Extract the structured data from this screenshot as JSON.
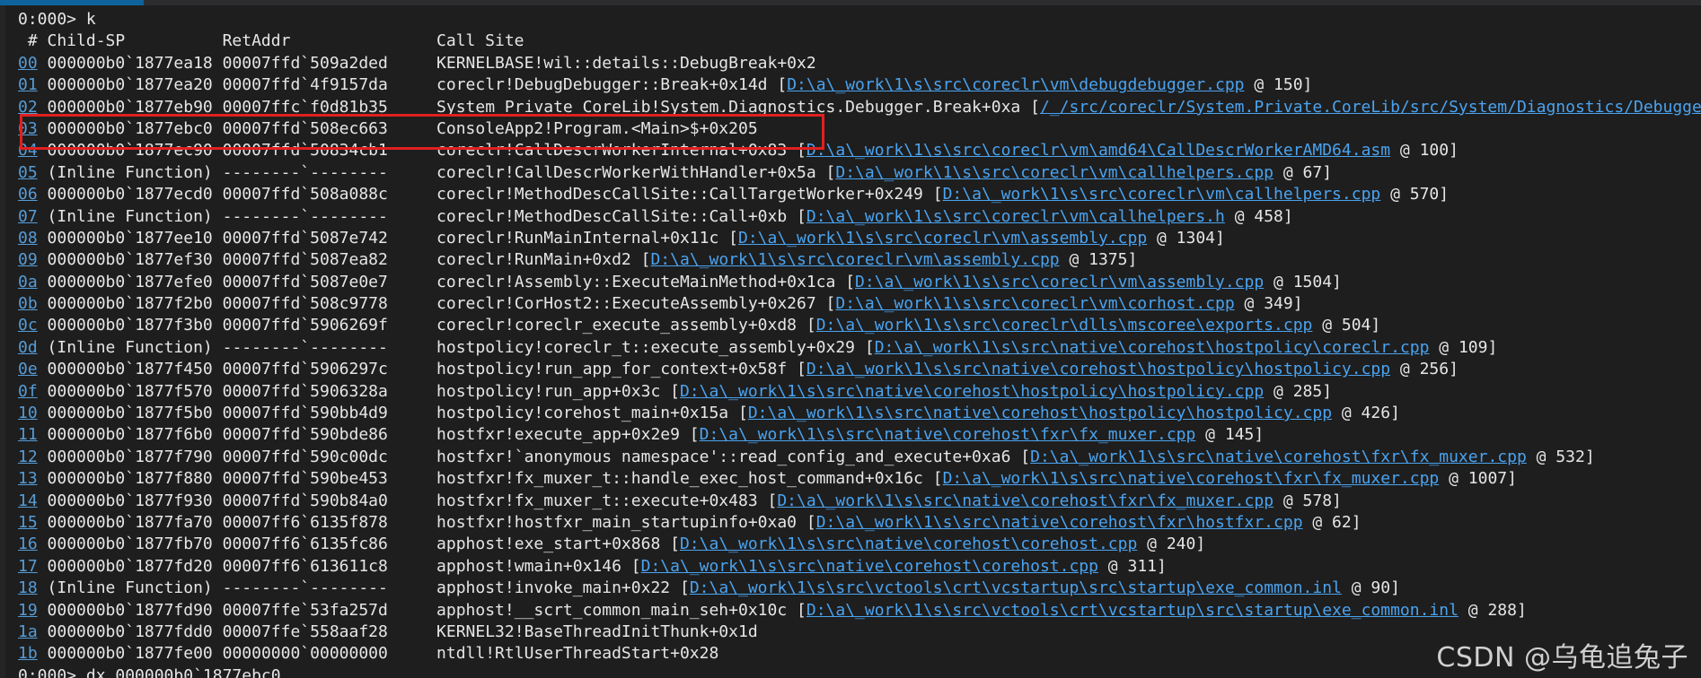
{
  "console": {
    "prompt_line": "0:000> k",
    "header": " # Child-SP          RetAddr               Call Site",
    "frames": [
      {
        "num": "00",
        "child_sp": "000000b0`1877ea18",
        "ret_addr": "00007ffd`509a2ded",
        "call_site": "KERNELBASE!wil::details::DebugBreak+0x2",
        "source_path": "",
        "line_suffix": ""
      },
      {
        "num": "01",
        "child_sp": "000000b0`1877ea20",
        "ret_addr": "00007ffd`4f9157da",
        "call_site": "coreclr!DebugDebugger::Break+0x14d",
        "source_path": "D:\\a\\_work\\1\\s\\src\\coreclr\\vm\\debugdebugger.cpp",
        "line_suffix": " @ 150]"
      },
      {
        "num": "02",
        "child_sp": "000000b0`1877eb90",
        "ret_addr": "00007ffc`f0d81b35",
        "call_site": "System_Private_CoreLib!System.Diagnostics.Debugger.Break+0xa",
        "source_path": "/_/src/coreclr/System.Private.CoreLib/src/System/Diagnostics/Debugger.cs",
        "line_suffix": ""
      },
      {
        "num": "03",
        "child_sp": "000000b0`1877ebc0",
        "ret_addr": "00007ffd`508ec663",
        "call_site": "ConsoleApp2!Program.<Main>$+0x205",
        "source_path": "",
        "line_suffix": ""
      },
      {
        "num": "04",
        "child_sp": "000000b0`1877ec90",
        "ret_addr": "00007ffd`50834cb1",
        "call_site": "coreclr!CallDescrWorkerInternal+0x83",
        "source_path": "D:\\a\\_work\\1\\s\\src\\coreclr\\vm\\amd64\\CallDescrWorkerAMD64.asm",
        "line_suffix": " @ 100]"
      },
      {
        "num": "05",
        "child_sp": "(Inline Function)",
        "ret_addr": "--------`--------",
        "call_site": "coreclr!CallDescrWorkerWithHandler+0x5a",
        "source_path": "D:\\a\\_work\\1\\s\\src\\coreclr\\vm\\callhelpers.cpp",
        "line_suffix": " @ 67]"
      },
      {
        "num": "06",
        "child_sp": "000000b0`1877ecd0",
        "ret_addr": "00007ffd`508a088c",
        "call_site": "coreclr!MethodDescCallSite::CallTargetWorker+0x249",
        "source_path": "D:\\a\\_work\\1\\s\\src\\coreclr\\vm\\callhelpers.cpp",
        "line_suffix": " @ 570]"
      },
      {
        "num": "07",
        "child_sp": "(Inline Function)",
        "ret_addr": "--------`--------",
        "call_site": "coreclr!MethodDescCallSite::Call+0xb",
        "source_path": "D:\\a\\_work\\1\\s\\src\\coreclr\\vm\\callhelpers.h",
        "line_suffix": " @ 458]"
      },
      {
        "num": "08",
        "child_sp": "000000b0`1877ee10",
        "ret_addr": "00007ffd`5087e742",
        "call_site": "coreclr!RunMainInternal+0x11c",
        "source_path": "D:\\a\\_work\\1\\s\\src\\coreclr\\vm\\assembly.cpp",
        "line_suffix": " @ 1304]"
      },
      {
        "num": "09",
        "child_sp": "000000b0`1877ef30",
        "ret_addr": "00007ffd`5087ea82",
        "call_site": "coreclr!RunMain+0xd2",
        "source_path": "D:\\a\\_work\\1\\s\\src\\coreclr\\vm\\assembly.cpp",
        "line_suffix": " @ 1375]"
      },
      {
        "num": "0a",
        "child_sp": "000000b0`1877efe0",
        "ret_addr": "00007ffd`5087e0e7",
        "call_site": "coreclr!Assembly::ExecuteMainMethod+0x1ca",
        "source_path": "D:\\a\\_work\\1\\s\\src\\coreclr\\vm\\assembly.cpp",
        "line_suffix": " @ 1504]"
      },
      {
        "num": "0b",
        "child_sp": "000000b0`1877f2b0",
        "ret_addr": "00007ffd`508c9778",
        "call_site": "coreclr!CorHost2::ExecuteAssembly+0x267",
        "source_path": "D:\\a\\_work\\1\\s\\src\\coreclr\\vm\\corhost.cpp",
        "line_suffix": " @ 349]"
      },
      {
        "num": "0c",
        "child_sp": "000000b0`1877f3b0",
        "ret_addr": "00007ffd`5906269f",
        "call_site": "coreclr!coreclr_execute_assembly+0xd8",
        "source_path": "D:\\a\\_work\\1\\s\\src\\coreclr\\dlls\\mscoree\\exports.cpp",
        "line_suffix": " @ 504]"
      },
      {
        "num": "0d",
        "child_sp": "(Inline Function)",
        "ret_addr": "--------`--------",
        "call_site": "hostpolicy!coreclr_t::execute_assembly+0x29",
        "source_path": "D:\\a\\_work\\1\\s\\src\\native\\corehost\\hostpolicy\\coreclr.cpp",
        "line_suffix": " @ 109]"
      },
      {
        "num": "0e",
        "child_sp": "000000b0`1877f450",
        "ret_addr": "00007ffd`5906297c",
        "call_site": "hostpolicy!run_app_for_context+0x58f",
        "source_path": "D:\\a\\_work\\1\\s\\src\\native\\corehost\\hostpolicy\\hostpolicy.cpp",
        "line_suffix": " @ 256]"
      },
      {
        "num": "0f",
        "child_sp": "000000b0`1877f570",
        "ret_addr": "00007ffd`5906328a",
        "call_site": "hostpolicy!run_app+0x3c",
        "source_path": "D:\\a\\_work\\1\\s\\src\\native\\corehost\\hostpolicy\\hostpolicy.cpp",
        "line_suffix": " @ 285]"
      },
      {
        "num": "10",
        "child_sp": "000000b0`1877f5b0",
        "ret_addr": "00007ffd`590bb4d9",
        "call_site": "hostpolicy!corehost_main+0x15a",
        "source_path": "D:\\a\\_work\\1\\s\\src\\native\\corehost\\hostpolicy\\hostpolicy.cpp",
        "line_suffix": " @ 426]"
      },
      {
        "num": "11",
        "child_sp": "000000b0`1877f6b0",
        "ret_addr": "00007ffd`590bde86",
        "call_site": "hostfxr!execute_app+0x2e9",
        "source_path": "D:\\a\\_work\\1\\s\\src\\native\\corehost\\fxr\\fx_muxer.cpp",
        "line_suffix": " @ 145]"
      },
      {
        "num": "12",
        "child_sp": "000000b0`1877f790",
        "ret_addr": "00007ffd`590c00dc",
        "call_site": "hostfxr!`anonymous namespace'::read_config_and_execute+0xa6",
        "source_path": "D:\\a\\_work\\1\\s\\src\\native\\corehost\\fxr\\fx_muxer.cpp",
        "line_suffix": " @ 532]"
      },
      {
        "num": "13",
        "child_sp": "000000b0`1877f880",
        "ret_addr": "00007ffd`590be453",
        "call_site": "hostfxr!fx_muxer_t::handle_exec_host_command+0x16c",
        "source_path": "D:\\a\\_work\\1\\s\\src\\native\\corehost\\fxr\\fx_muxer.cpp",
        "line_suffix": " @ 1007]"
      },
      {
        "num": "14",
        "child_sp": "000000b0`1877f930",
        "ret_addr": "00007ffd`590b84a0",
        "call_site": "hostfxr!fx_muxer_t::execute+0x483",
        "source_path": "D:\\a\\_work\\1\\s\\src\\native\\corehost\\fxr\\fx_muxer.cpp",
        "line_suffix": " @ 578]"
      },
      {
        "num": "15",
        "child_sp": "000000b0`1877fa70",
        "ret_addr": "00007ff6`6135f878",
        "call_site": "hostfxr!hostfxr_main_startupinfo+0xa0",
        "source_path": "D:\\a\\_work\\1\\s\\src\\native\\corehost\\fxr\\hostfxr.cpp",
        "line_suffix": " @ 62]"
      },
      {
        "num": "16",
        "child_sp": "000000b0`1877fb70",
        "ret_addr": "00007ff6`6135fc86",
        "call_site": "apphost!exe_start+0x868",
        "source_path": "D:\\a\\_work\\1\\s\\src\\native\\corehost\\corehost.cpp",
        "line_suffix": " @ 240]"
      },
      {
        "num": "17",
        "child_sp": "000000b0`1877fd20",
        "ret_addr": "00007ff6`613611c8",
        "call_site": "apphost!wmain+0x146",
        "source_path": "D:\\a\\_work\\1\\s\\src\\native\\corehost\\corehost.cpp",
        "line_suffix": " @ 311]"
      },
      {
        "num": "18",
        "child_sp": "(Inline Function)",
        "ret_addr": "--------`--------",
        "call_site": "apphost!invoke_main+0x22",
        "source_path": "D:\\a\\_work\\1\\s\\src\\vctools\\crt\\vcstartup\\src\\startup\\exe_common.inl",
        "line_suffix": " @ 90]"
      },
      {
        "num": "19",
        "child_sp": "000000b0`1877fd90",
        "ret_addr": "00007ffe`53fa257d",
        "call_site": "apphost!__scrt_common_main_seh+0x10c",
        "source_path": "D:\\a\\_work\\1\\s\\src\\vctools\\crt\\vcstartup\\src\\startup\\exe_common.inl",
        "line_suffix": " @ 288]"
      },
      {
        "num": "1a",
        "child_sp": "000000b0`1877fdd0",
        "ret_addr": "00007ffe`558aaf28",
        "call_site": "KERNEL32!BaseThreadInitThunk+0x1d",
        "source_path": "",
        "line_suffix": ""
      },
      {
        "num": "1b",
        "child_sp": "000000b0`1877fe00",
        "ret_addr": "00000000`00000000",
        "call_site": "ntdll!RtlUserThreadStart+0x28",
        "source_path": "",
        "line_suffix": ""
      }
    ],
    "next_prompt": "0:000> dx 000000b0`1877ebc0"
  },
  "watermark": "CSDN @乌龟追兔子",
  "colors": {
    "background": "#1e1e1e",
    "text": "#e6e6e6",
    "link": "#4aa3f0",
    "highlight": "#e02020"
  }
}
